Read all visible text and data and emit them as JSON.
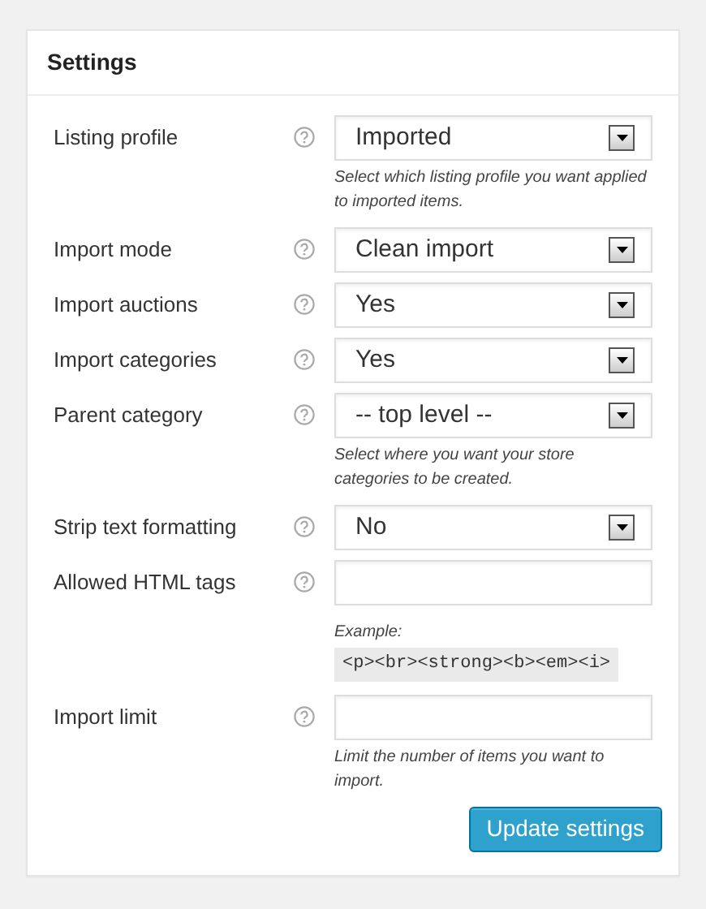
{
  "panel": {
    "title": "Settings"
  },
  "fields": [
    {
      "label": "Listing profile",
      "kind": "select",
      "value": "Imported",
      "description": "Select which listing profile you want applied to imported items."
    },
    {
      "label": "Import mode",
      "kind": "select",
      "value": "Clean import"
    },
    {
      "label": "Import auctions",
      "kind": "select",
      "value": "Yes"
    },
    {
      "label": "Import categories",
      "kind": "select",
      "value": "Yes"
    },
    {
      "label": "Parent category",
      "kind": "select",
      "value": "-- top level --",
      "description": "Select where you want your store categories to be created."
    },
    {
      "label": "Strip text formatting",
      "kind": "select",
      "value": "No"
    },
    {
      "label": "Allowed HTML tags",
      "kind": "text",
      "example_label": "Example:",
      "example_code": "<p><br><strong><b><em><i>"
    },
    {
      "label": "Import limit",
      "kind": "text",
      "description": "Limit the number of items you want to import."
    }
  ],
  "submit_button": "Update settings"
}
